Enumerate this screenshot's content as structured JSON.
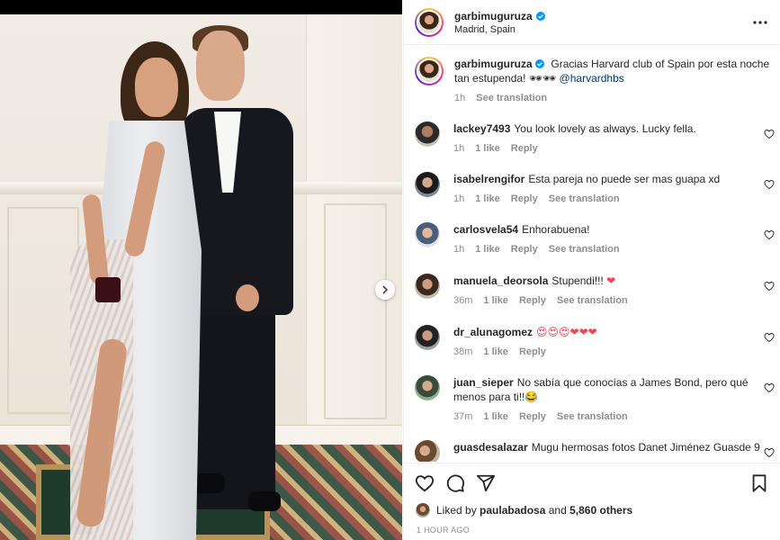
{
  "post": {
    "username": "garbimuguruza",
    "location": "Madrid, Spain",
    "caption": {
      "text": "Gracias Harvard club of Spain por esta noche tan estupenda! ",
      "emojis": "🕶🕶",
      "mention": "@harvardhbs",
      "time": "1h",
      "see_translation": "See translation"
    }
  },
  "comments": [
    {
      "author": "lackey7493",
      "text": "You look lovely as always. Lucky fella.",
      "emoji": "",
      "time": "1h",
      "likes": "1 like",
      "reply": "Reply",
      "translation": ""
    },
    {
      "author": "isabelrengifor",
      "text": "Esta pareja no puede ser mas guapa xd",
      "emoji": "",
      "time": "1h",
      "likes": "1 like",
      "reply": "Reply",
      "translation": "See translation"
    },
    {
      "author": "carlosvela54",
      "text": "Enhorabuena!",
      "emoji": "",
      "time": "1h",
      "likes": "1 like",
      "reply": "Reply",
      "translation": "See translation"
    },
    {
      "author": "manuela_deorsola",
      "text": "Stupendi!!! ",
      "emoji": "❤",
      "time": "36m",
      "likes": "1 like",
      "reply": "Reply",
      "translation": "See translation"
    },
    {
      "author": "dr_alunagomez",
      "text": "",
      "emoji": "😍😍😍❤❤❤",
      "time": "38m",
      "likes": "1 like",
      "reply": "Reply",
      "translation": ""
    },
    {
      "author": "juan_sieper",
      "text": "No sabía que conocías a James Bond, pero qué menos para ti!!",
      "emoji": "😂",
      "time": "37m",
      "likes": "1 like",
      "reply": "Reply",
      "translation": "See translation"
    },
    {
      "author": "guasdesalazar",
      "text": "Mugu hermosas fotos Danet Jiménez Guasde 9",
      "emoji": "",
      "time": "",
      "likes": "",
      "reply": "",
      "translation": ""
    }
  ],
  "likes": {
    "prefix": "Liked by",
    "user": "paulabadosa",
    "joiner": "and",
    "others": "5,860 others"
  },
  "timestamp": "1 HOUR AGO",
  "colors": {
    "verified": "#0095f6",
    "heart": "#ed4956",
    "secondary_text": "#8e8e8e",
    "mention": "#00376b"
  },
  "icons": [
    "verified-badge-icon",
    "more-options-icon",
    "chevron-right-icon",
    "heart-icon",
    "comment-icon",
    "share-icon",
    "bookmark-icon"
  ]
}
